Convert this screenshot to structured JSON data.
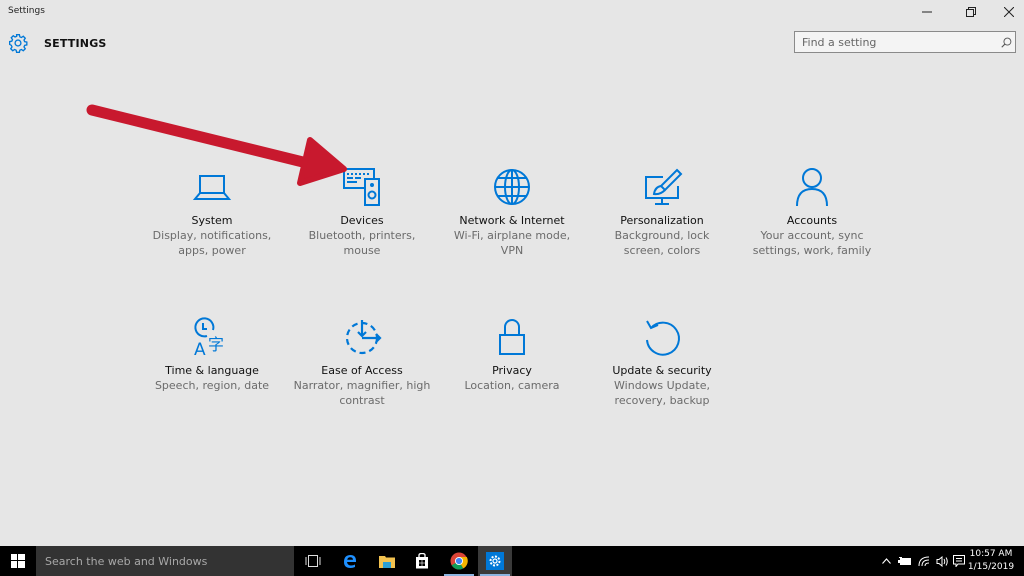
{
  "window": {
    "title": "Settings",
    "controls": {
      "minimize": "–",
      "maximize": "❐",
      "close": "✕"
    }
  },
  "header": {
    "icon": "gear-icon",
    "title": "SETTINGS",
    "search_placeholder": "Find a setting",
    "search_value": ""
  },
  "accent_color": "#0078d7",
  "annotation_color": "#c8192e",
  "tiles": [
    {
      "id": "system",
      "icon": "laptop-icon",
      "name": "System",
      "desc": "Display, notifications, apps, power"
    },
    {
      "id": "devices",
      "icon": "devices-icon",
      "name": "Devices",
      "desc": "Bluetooth, printers, mouse"
    },
    {
      "id": "network",
      "icon": "globe-icon",
      "name": "Network & Internet",
      "desc": "Wi-Fi, airplane mode, VPN"
    },
    {
      "id": "personalization",
      "icon": "paintbrush-monitor-icon",
      "name": "Personalization",
      "desc": "Background, lock screen, colors"
    },
    {
      "id": "accounts",
      "icon": "person-icon",
      "name": "Accounts",
      "desc": "Your account, sync settings, work, family"
    },
    {
      "id": "time-language",
      "icon": "clock-language-icon",
      "name": "Time & language",
      "desc": "Speech, region, date"
    },
    {
      "id": "ease-of-access",
      "icon": "ease-of-access-icon",
      "name": "Ease of Access",
      "desc": "Narrator, magnifier, high contrast"
    },
    {
      "id": "privacy",
      "icon": "lock-icon",
      "name": "Privacy",
      "desc": "Location, camera"
    },
    {
      "id": "update-security",
      "icon": "refresh-icon",
      "name": "Update & security",
      "desc": "Windows Update, recovery, backup"
    }
  ],
  "taskbar": {
    "search_placeholder": "Search the web and Windows",
    "apps": [
      {
        "name": "task-view",
        "icon": "task-view-icon"
      },
      {
        "name": "edge",
        "icon": "edge-icon"
      },
      {
        "name": "file-explorer",
        "icon": "folder-icon"
      },
      {
        "name": "store",
        "icon": "store-bag-icon"
      },
      {
        "name": "chrome",
        "icon": "chrome-icon"
      },
      {
        "name": "settings",
        "icon": "gear-icon",
        "active": true
      }
    ],
    "tray": {
      "icons": [
        "chevron-up-icon",
        "battery-icon",
        "wifi-icon",
        "volume-icon",
        "action-center-icon"
      ],
      "time": "10:57 AM",
      "date": "1/15/2019"
    }
  }
}
